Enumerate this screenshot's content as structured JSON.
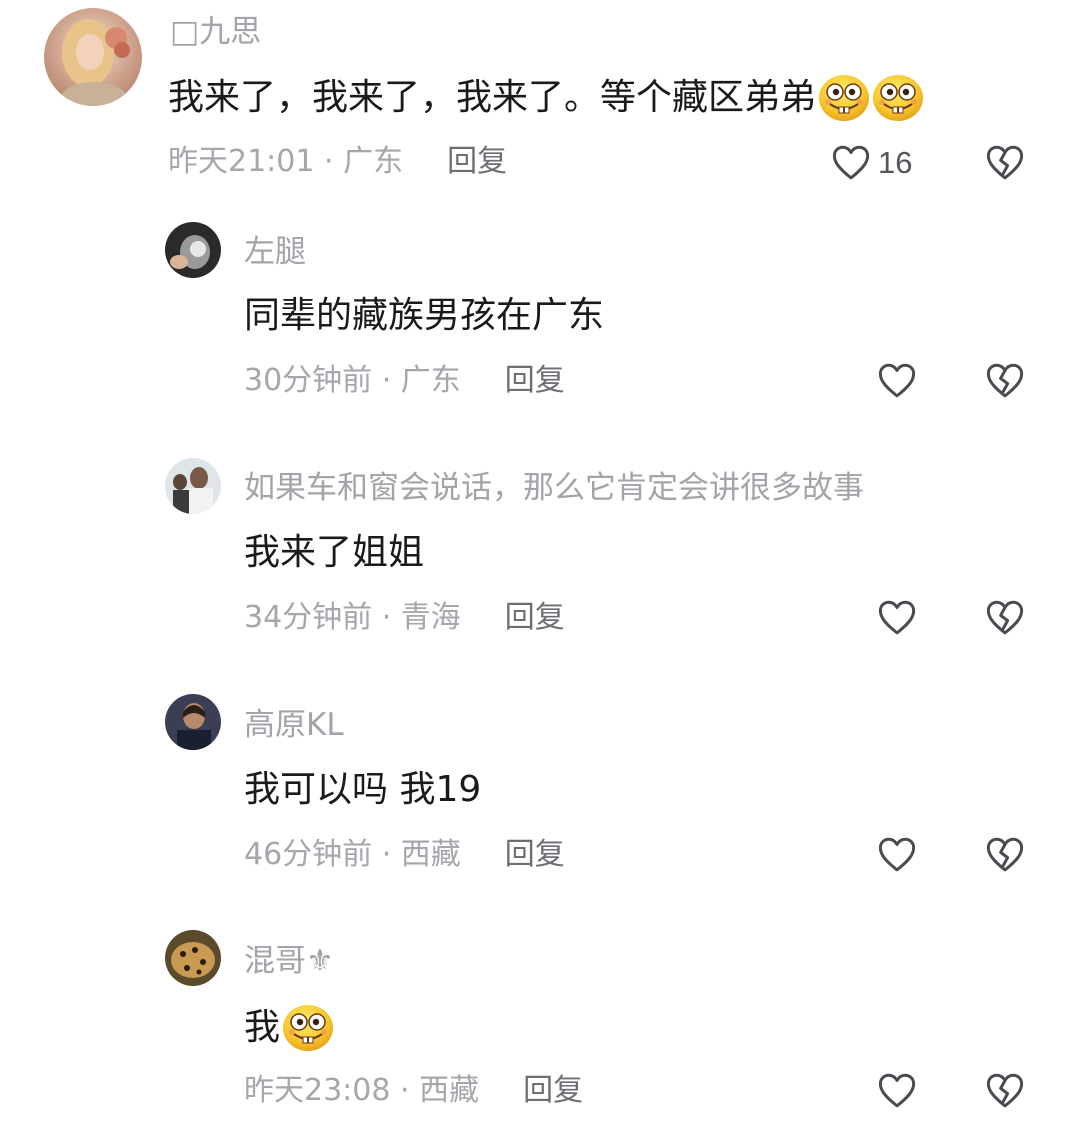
{
  "comments": [
    {
      "username": "□九思",
      "text": "我来了，我来了，我来了。等个藏区弟弟",
      "time_location": "昨天21:01 · 广东",
      "reply_label": "回复",
      "likes": "16",
      "emoji": [
        "grin-face-icon",
        "grin-face-icon"
      ]
    },
    {
      "username": "左腿",
      "text": "同辈的藏族男孩在广东",
      "time_location": "30分钟前 · 广东",
      "reply_label": "回复"
    },
    {
      "username": "如果车和窗会说话，那么它肯定会讲很多故事",
      "text": "我来了姐姐",
      "time_location": "34分钟前 · 青海",
      "reply_label": "回复"
    },
    {
      "username": "高原KL",
      "text": "我可以吗 我19",
      "time_location": "46分钟前 · 西藏",
      "reply_label": "回复"
    },
    {
      "username": "混哥⚜",
      "text": "我",
      "time_location": "昨天23:08 · 西藏",
      "reply_label": "回复",
      "emoji": [
        "grin-face-icon"
      ]
    }
  ],
  "colors": {
    "username": "#a3a3a9",
    "text": "#1a1a1a",
    "meta": "#a6a6ac",
    "icon": "#4a4a50"
  }
}
